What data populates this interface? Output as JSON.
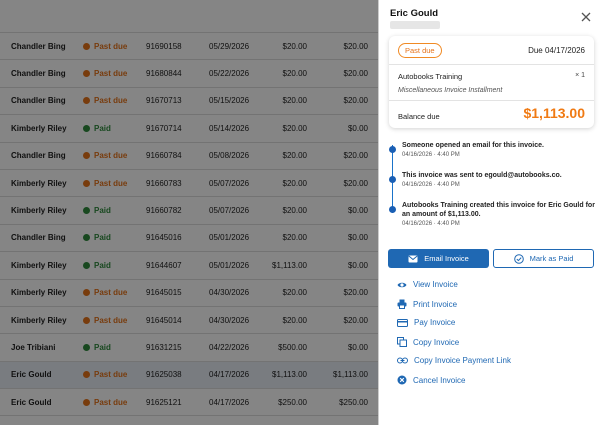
{
  "table": {
    "rows": [
      {
        "name": "Chandler Bing",
        "status": "Past due",
        "status_color": "#e6731a",
        "number": "91690158",
        "date": "05/29/2026",
        "amount": "$20.00",
        "balance": "$20.00"
      },
      {
        "name": "Chandler Bing",
        "status": "Past due",
        "status_color": "#e6731a",
        "number": "91680844",
        "date": "05/22/2026",
        "amount": "$20.00",
        "balance": "$20.00"
      },
      {
        "name": "Chandler Bing",
        "status": "Past due",
        "status_color": "#e6731a",
        "number": "91670713",
        "date": "05/15/2026",
        "amount": "$20.00",
        "balance": "$20.00"
      },
      {
        "name": "Kimberly Riley",
        "status": "Paid",
        "status_color": "#2e8b3d",
        "number": "91670714",
        "date": "05/14/2026",
        "amount": "$20.00",
        "balance": "$0.00"
      },
      {
        "name": "Chandler Bing",
        "status": "Past due",
        "status_color": "#e6731a",
        "number": "91660784",
        "date": "05/08/2026",
        "amount": "$20.00",
        "balance": "$20.00"
      },
      {
        "name": "Kimberly Riley",
        "status": "Past due",
        "status_color": "#e6731a",
        "number": "91660783",
        "date": "05/07/2026",
        "amount": "$20.00",
        "balance": "$20.00"
      },
      {
        "name": "Kimberly Riley",
        "status": "Paid",
        "status_color": "#2e8b3d",
        "number": "91660782",
        "date": "05/07/2026",
        "amount": "$20.00",
        "balance": "$0.00"
      },
      {
        "name": "Chandler Bing",
        "status": "Paid",
        "status_color": "#2e8b3d",
        "number": "91645016",
        "date": "05/01/2026",
        "amount": "$20.00",
        "balance": "$0.00"
      },
      {
        "name": "Kimberly Riley",
        "status": "Paid",
        "status_color": "#2e8b3d",
        "number": "91644607",
        "date": "05/01/2026",
        "amount": "$1,113.00",
        "balance": "$0.00"
      },
      {
        "name": "Kimberly Riley",
        "status": "Past due",
        "status_color": "#e6731a",
        "number": "91645015",
        "date": "04/30/2026",
        "amount": "$20.00",
        "balance": "$20.00"
      },
      {
        "name": "Kimberly Riley",
        "status": "Past due",
        "status_color": "#e6731a",
        "number": "91645014",
        "date": "04/30/2026",
        "amount": "$20.00",
        "balance": "$20.00"
      },
      {
        "name": "Joe Tribiani",
        "status": "Paid",
        "status_color": "#2e8b3d",
        "number": "91631215",
        "date": "04/22/2026",
        "amount": "$500.00",
        "balance": "$0.00"
      },
      {
        "name": "Eric Gould",
        "status": "Past due",
        "status_color": "#e6731a",
        "number": "91625038",
        "date": "04/17/2026",
        "amount": "$1,113.00",
        "balance": "$1,113.00",
        "selected": true
      },
      {
        "name": "Eric Gould",
        "status": "Past due",
        "status_color": "#e6731a",
        "number": "91625121",
        "date": "04/17/2026",
        "amount": "$250.00",
        "balance": "$250.00"
      }
    ]
  },
  "panel": {
    "title": "Eric Gould",
    "close_icon": "close-icon",
    "card": {
      "status": "Past due",
      "due_date": "Due 04/17/2026",
      "item_name": "Autobooks Training",
      "quantity": "× 1",
      "item_desc": "Miscellaneous Invoice Installment",
      "balance_label": "Balance due",
      "balance_value": "$1,113.00"
    },
    "timeline": [
      {
        "text": "Someone opened an email for this invoice.",
        "time": "04/16/2026 · 4:40 PM"
      },
      {
        "text": "This invoice was sent to egould@autobooks.co.",
        "time": "04/16/2026 · 4:40 PM"
      },
      {
        "text": "Autobooks Training created this invoice for Eric Gould for an amount of $1,113.00.",
        "time": "04/16/2026 · 4:40 PM"
      }
    ],
    "buttons": {
      "email": "Email Invoice",
      "mark_paid": "Mark as Paid"
    },
    "actions": [
      {
        "label": "View Invoice",
        "icon": "eye-icon"
      },
      {
        "label": "Print Invoice",
        "icon": "printer-icon"
      },
      {
        "label": "Pay Invoice",
        "icon": "credit-card-icon"
      },
      {
        "label": "Copy Invoice",
        "icon": "copy-icon"
      },
      {
        "label": "Copy Invoice Payment Link",
        "icon": "link-icon"
      },
      {
        "label": "Cancel Invoice",
        "icon": "cancel-icon"
      }
    ],
    "colors": {
      "accent": "#1f68b3",
      "past_due": "#e6731a",
      "paid": "#2e8b3d"
    }
  }
}
